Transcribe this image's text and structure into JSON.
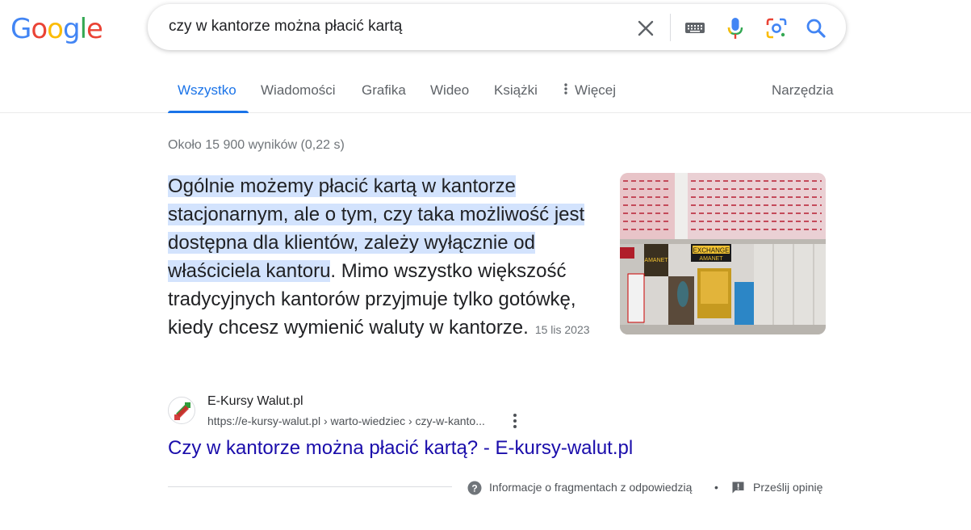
{
  "logo": {
    "letters": [
      "G",
      "o",
      "o",
      "g",
      "l",
      "e"
    ],
    "colors": [
      "#4285F4",
      "#EA4335",
      "#FBBC05",
      "#4285F4",
      "#34A853",
      "#EA4335"
    ]
  },
  "search": {
    "query": "czy w kantorze można płacić kartą",
    "icons": [
      "close-icon",
      "keyboard-icon",
      "microphone-icon",
      "lens-icon",
      "search-icon"
    ]
  },
  "tabs": {
    "items": [
      {
        "label": "Wszystko",
        "active": true
      },
      {
        "label": "Wiadomości"
      },
      {
        "label": "Grafika"
      },
      {
        "label": "Wideo"
      },
      {
        "label": "Książki"
      },
      {
        "label": "Więcej"
      }
    ],
    "tools": "Narzędzia"
  },
  "stats": "Około 15 900 wyników (0,22 s)",
  "snippet": {
    "highlighted": "Ogólnie możemy płacić kartą w kantorze stacjonarnym, ale o tym, czy taka możliwość jest dostępna dla klientów, zależy wyłącznie od właściciela kantoru",
    "rest": ". Mimo wszystko większość tradycyjnych kantorów przyjmuje tylko gotówkę, kiedy chcesz wymienić waluty w kantorze.",
    "date": "15 lis 2023",
    "image_signs": [
      "EXCHANGE",
      "AMANET",
      "AMANET"
    ]
  },
  "source": {
    "site_name": "E-Kursy Walut.pl",
    "url": "https://e-kursy-walut.pl › warto-wiedziec › czy-w-kanto...",
    "title": "Czy w kantorze można płacić kartą? - E-kursy-walut.pl"
  },
  "footer": {
    "info": "Informacje o fragmentach z odpowiedzią",
    "separator": "•",
    "feedback": "Prześlij opinię"
  },
  "colors": {
    "accent": "#1a73e8",
    "link": "#1a0dab",
    "highlight": "#d3e3fd"
  }
}
